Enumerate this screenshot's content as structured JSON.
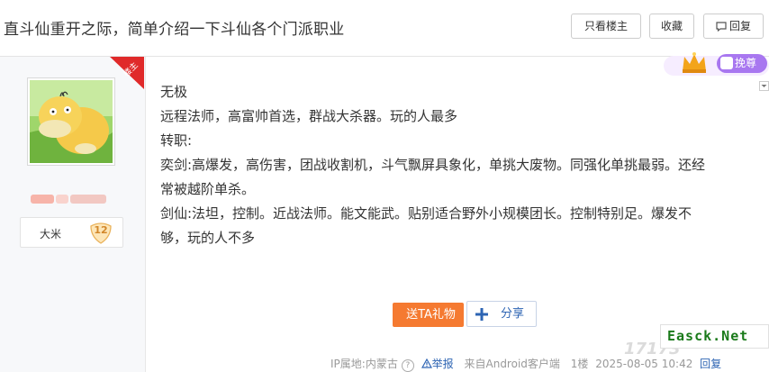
{
  "header": {
    "title": "直斗仙重开之际，简单介绍一下斗仙各个门派职业",
    "only_op_label": "只看楼主",
    "favorite_label": "收藏",
    "reply_label": "回复"
  },
  "author": {
    "op_tag": "楼主",
    "level_name": "大米",
    "level_number": "12"
  },
  "vip": {
    "label": "挽尊"
  },
  "post": {
    "lines": [
      "无极",
      "远程法师，高富帅首选，群战大杀器。玩的人最多",
      "转职:",
      "奕剑:高爆发，高伤害，团战收割机，斗气飘屏具象化，单挑大废物。同强化单挑最弱。还经",
      "常被越阶单杀。",
      "剑仙:法坦，控制。近战法师。能文能武。贴别适合野外小规模团长。控制特别足。爆发不",
      "够，玩的人不多"
    ]
  },
  "actions": {
    "gift_label": "送TA礼物",
    "share_label": "分享"
  },
  "footer": {
    "ip_location": "IP属地:内蒙古",
    "report_label": "举报",
    "client": "来自Android客户端",
    "floor": "1楼",
    "datetime": "2025-08-05 10:42",
    "reply_label": "回复"
  },
  "watermark": {
    "text": "Easck.Net",
    "faint_text": "17173"
  },
  "colors": {
    "gift": "#f57a31",
    "link": "#2d64b3",
    "vip": "#a877f0",
    "op_ribbon": "#e02a2a"
  }
}
